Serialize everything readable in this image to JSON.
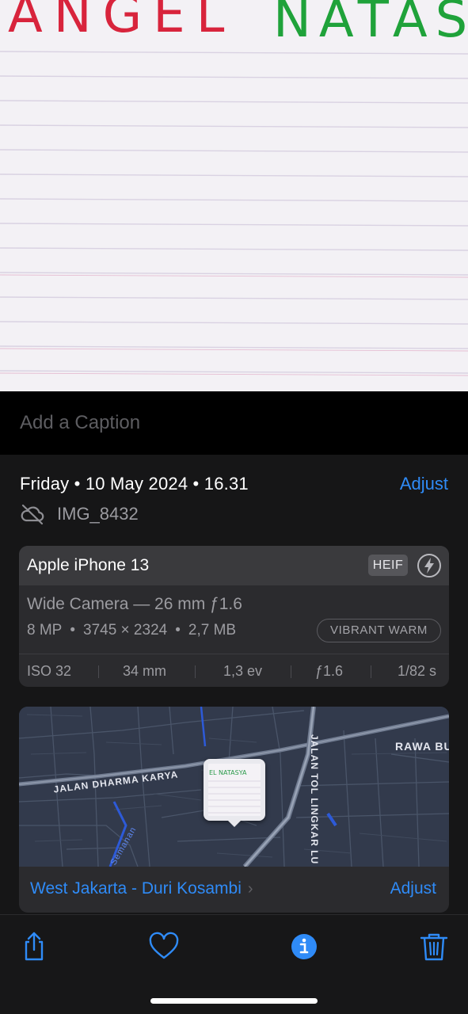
{
  "photo": {
    "handwriting_left": "ANGEL",
    "handwriting_right": "NATASA"
  },
  "caption": {
    "placeholder": "Add a Caption"
  },
  "info": {
    "date": "Friday • 10 May 2024 • 16.31",
    "adjust": "Adjust",
    "icloud_status_icon": "cloud-slash-icon",
    "filename": "IMG_8432"
  },
  "camera": {
    "model": "Apple iPhone 13",
    "format": "HEIF",
    "flash_icon": "flash-off-icon",
    "lens": "Wide Camera — 26 mm ƒ1.6",
    "megapixels": "8 MP",
    "resolution": "3745 × 2324",
    "size": "2,7 MB",
    "style": "VIBRANT WARM",
    "exif": {
      "iso": "ISO 32",
      "focal": "34 mm",
      "ev": "1,3 ev",
      "aperture": "ƒ1.6",
      "shutter": "1/82 s"
    }
  },
  "map": {
    "streets": {
      "dharma_karya": "JALAN DHARMA KARYA",
      "tol": "JALAN TOL LINGKAR LU",
      "rawa": "RAWA BU",
      "semanan": "Semanan"
    },
    "thumbnail_text": "EL NATASYA",
    "location": "West Jakarta - Duri Kosambi",
    "adjust": "Adjust"
  },
  "toolbar": {
    "share_icon": "share-icon",
    "favorite_icon": "heart-icon",
    "info_icon": "info-icon",
    "delete_icon": "trash-icon"
  },
  "colors": {
    "accent": "#2f8bf7",
    "panel_bg": "#161617",
    "card_bg": "#2b2b2e"
  }
}
